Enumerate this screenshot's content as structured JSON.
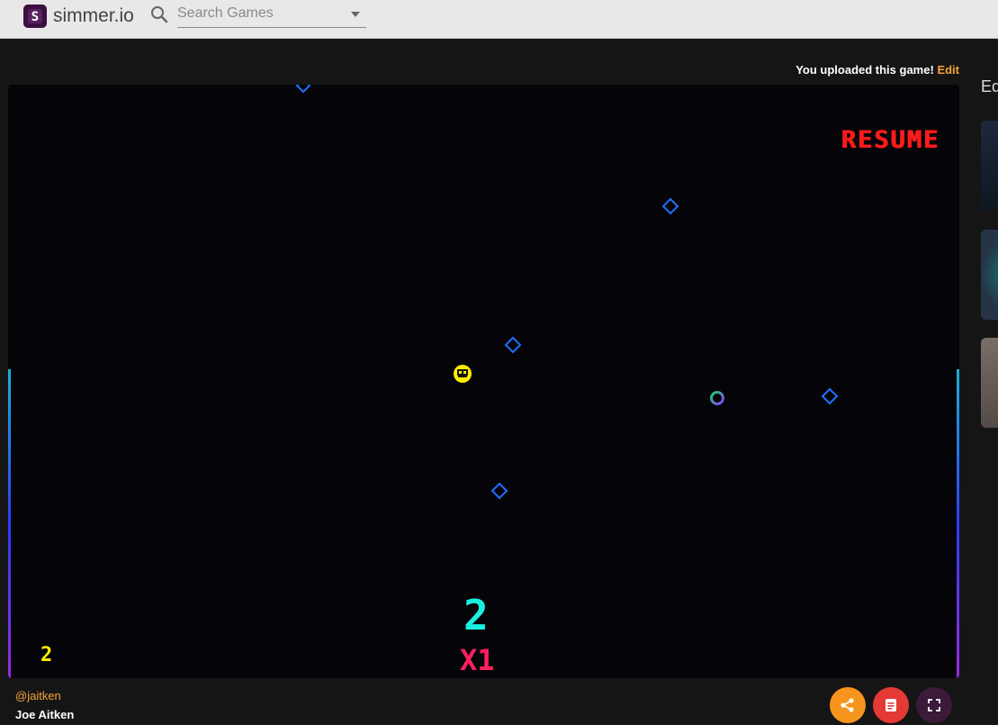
{
  "header": {
    "brand": "simmer.io",
    "search_placeholder": "Search Games"
  },
  "upload_notice": {
    "text": "You uploaded this game!",
    "edit_label": "Edit"
  },
  "game": {
    "resume_label": "RESUME",
    "score": "2",
    "multiplier": "X1",
    "lives": "2",
    "colors": {
      "background": "#050509",
      "resume": "#ff1a1a",
      "score": "#19f0e0",
      "multiplier": "#ff1f5e",
      "lives": "#ffee00",
      "diamond": "#1f6fff",
      "player": "#ffee00"
    }
  },
  "author": {
    "handle": "@jaitken",
    "name": "Joe Aitken"
  },
  "actions": {
    "share_icon": "share-icon",
    "notes_icon": "notes-icon",
    "fullscreen_icon": "fullscreen-icon"
  },
  "sidebar": {
    "label": "Ed"
  }
}
